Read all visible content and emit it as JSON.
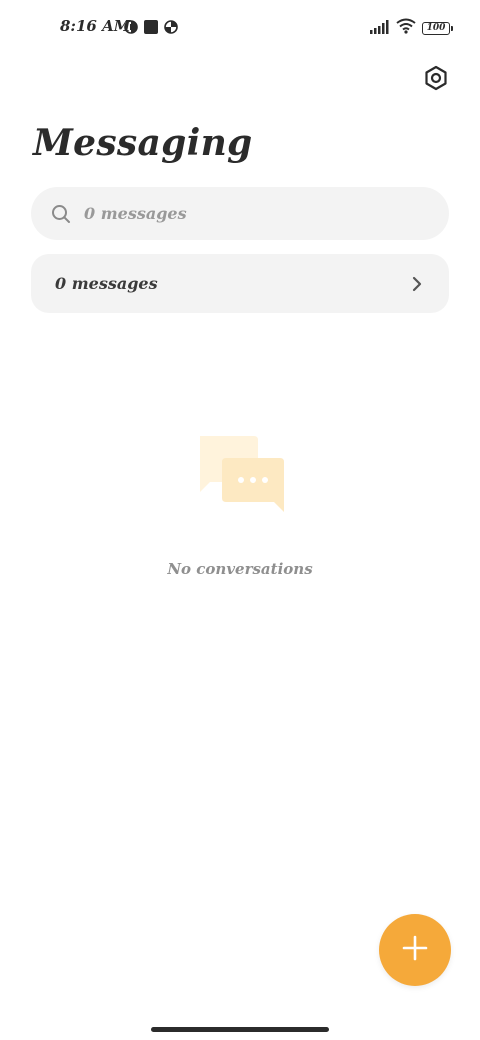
{
  "status_bar": {
    "time": "8:16 AM",
    "battery": "100",
    "icons_left": [
      "vpn-icon",
      "square-notification-icon",
      "vpn-icon"
    ],
    "icons_right": [
      "signal-icon",
      "wifi-icon",
      "battery-icon"
    ]
  },
  "header": {
    "title": "Messaging",
    "settings_icon": "settings-icon"
  },
  "search": {
    "placeholder": "0 messages",
    "value": ""
  },
  "messages_row": {
    "label": "0 messages"
  },
  "empty_state": {
    "text": "No conversations",
    "illustration": "chat-bubbles-icon"
  },
  "fab": {
    "icon": "plus-icon"
  },
  "colors": {
    "accent": "#f5a93a",
    "surface": "#f3f3f3",
    "text_primary": "#2b2b2b",
    "text_muted": "#8f8f8f",
    "illustration_light": "#fff3dc",
    "illustration_mid": "#fde9c2"
  }
}
